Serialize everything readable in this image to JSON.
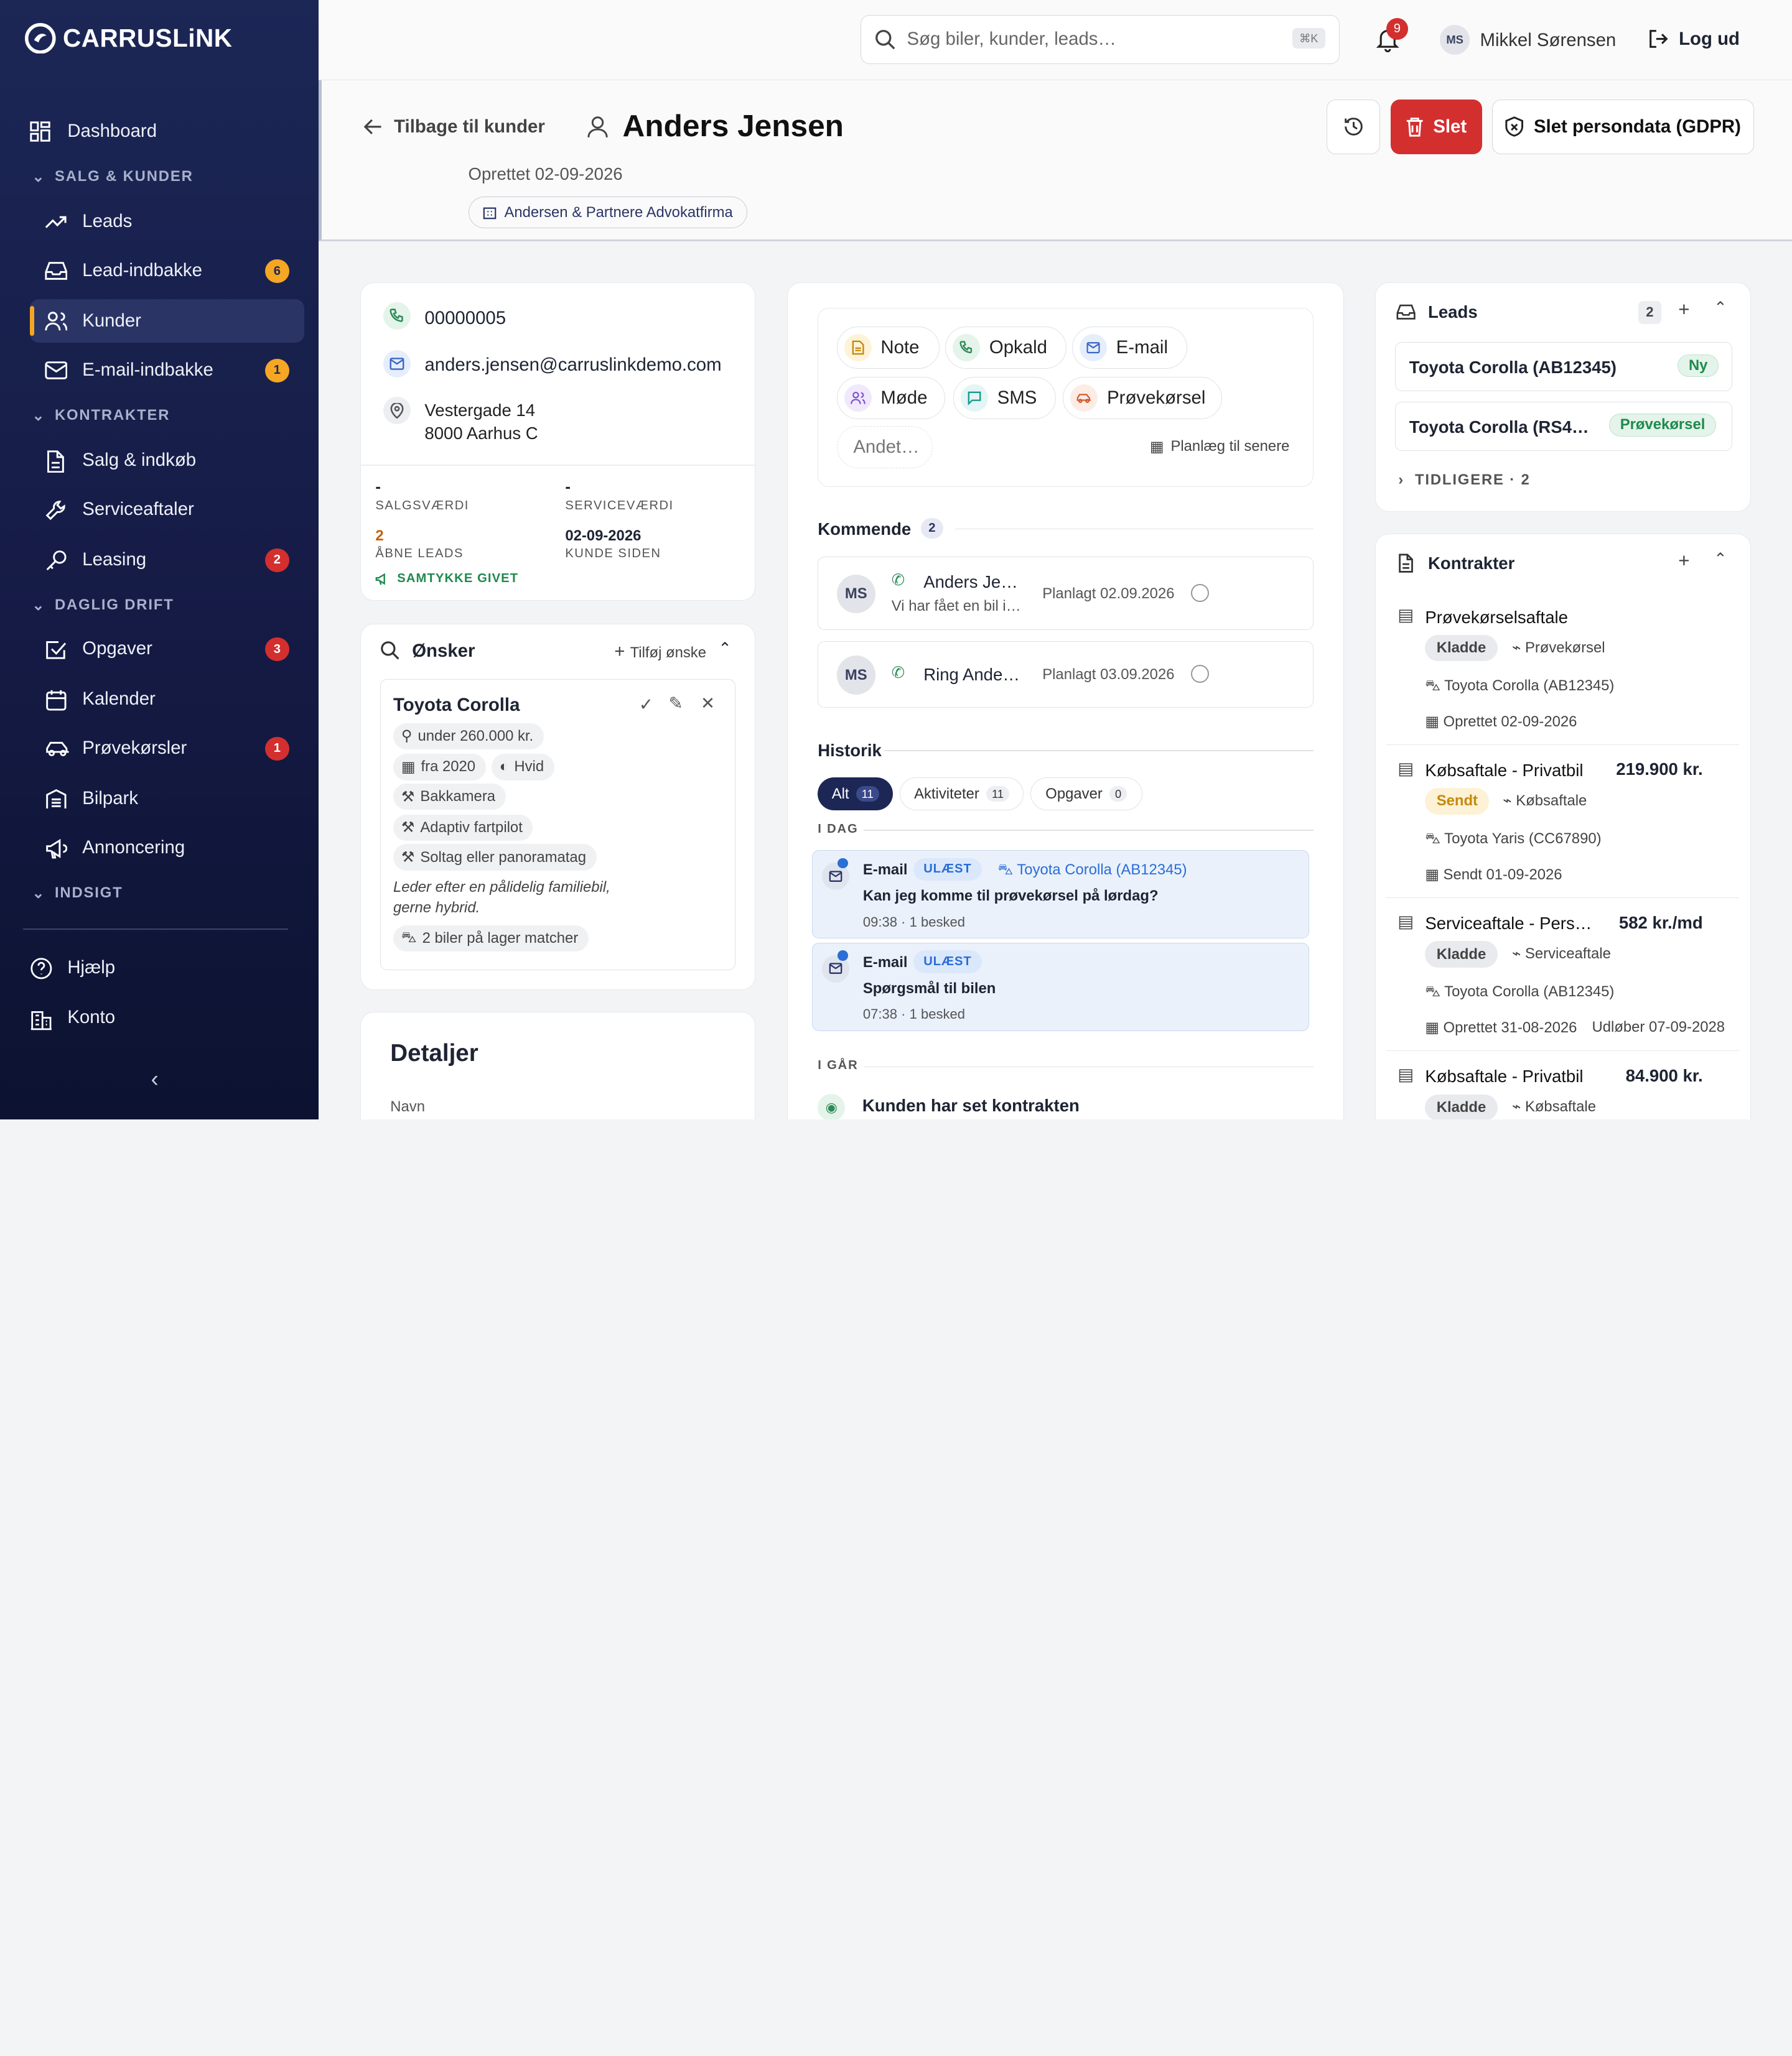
{
  "app": {
    "brand": "CARRUSLiNK"
  },
  "sidebar": {
    "dashboard": "Dashboard",
    "sections": [
      "SALG & KUNDER",
      "KONTRAKTER",
      "DAGLIG DRIFT",
      "INDSIGT"
    ],
    "items": [
      {
        "label": "Leads"
      },
      {
        "label": "Lead-indbakke",
        "badge": "6"
      },
      {
        "label": "Kunder"
      },
      {
        "label": "E-mail-indbakke",
        "badge": "1"
      },
      {
        "label": "Salg & indkøb"
      },
      {
        "label": "Serviceaftaler"
      },
      {
        "label": "Leasing",
        "badge": "2"
      },
      {
        "label": "Opgaver",
        "badge": "3"
      },
      {
        "label": "Kalender"
      },
      {
        "label": "Prøvekørsler",
        "badge": "1"
      },
      {
        "label": "Bilpark"
      },
      {
        "label": "Annoncering"
      }
    ],
    "help": "Hjælp",
    "account": "Konto"
  },
  "topbar": {
    "search_placeholder": "Søg biler, kunder, leads…",
    "shortcut": "⌘K",
    "notif_count": "9",
    "user_initials": "MS",
    "user_name": "Mikkel Sørensen",
    "logout": "Log ud"
  },
  "header": {
    "back": "Tilbage til kunder",
    "name": "Anders Jensen",
    "created": "Oprettet 02-09-2026",
    "company": "Andersen & Partnere Advokatfirma",
    "delete": "Slet",
    "gdpr": "Slet persondata (GDPR)"
  },
  "contact": {
    "phone": "00000005",
    "email": "anders.jensen@carruslinkdemo.com",
    "address1": "Vestergade 14",
    "address2": "8000 Aarhus C",
    "stats": {
      "salesval": "-",
      "salesval_lbl": "SALGSVÆRDI",
      "serviceval": "-",
      "serviceval_lbl": "SERVICEVÆRDI",
      "open_leads": "2",
      "open_leads_lbl": "ÅBNE LEADS",
      "since": "02-09-2026",
      "since_lbl": "KUNDE SIDEN",
      "consent": "SAMTYKKE GIVET"
    }
  },
  "wishes": {
    "title": "Ønsker",
    "add": "Tilføj ønske",
    "car": "Toyota Corolla",
    "price": "under 260.000 kr.",
    "year": "fra 2020",
    "color": "Hvid",
    "f1": "Bakkamera",
    "f2": "Adaptiv fartpilot",
    "f3": "Soltag eller panoramatag",
    "note1": "Leder efter en pålidelig familiebil,",
    "note2": "gerne hybrid.",
    "match": "2 biler på lager matcher"
  },
  "details": {
    "title": "Detaljer",
    "name_lbl": "Navn"
  },
  "activity": {
    "note": "Note",
    "call": "Opkald",
    "email": "E-mail",
    "meeting": "Møde",
    "sms": "SMS",
    "testdrive": "Prøvekørsel",
    "other": "Andet…",
    "schedule": "Planlæg til senere"
  },
  "upcoming": {
    "title": "Kommende",
    "count": "2",
    "items": [
      {
        "initials": "MS",
        "title": "Anders Je…",
        "sub": "Vi har fået en bil i…",
        "date": "Planlagt 02.09.2026"
      },
      {
        "initials": "MS",
        "title": "Ring Ande…",
        "sub": "",
        "date": "Planlagt 03.09.2026"
      }
    ]
  },
  "history": {
    "title": "Historik",
    "tabs": [
      {
        "label": "Alt",
        "count": "11"
      },
      {
        "label": "Aktiviteter",
        "count": "11"
      },
      {
        "label": "Opgaver",
        "count": "0"
      }
    ],
    "today": "I DAG",
    "yesterday": "I GÅR",
    "items": [
      {
        "type": "E-mail",
        "badge": "ULÆST",
        "car": "Toyota Corolla (AB12345)",
        "subject": "Kan jeg komme til prøvekørsel på lørdag?",
        "time": "09:38",
        "meta": "· 1 besked"
      },
      {
        "type": "E-mail",
        "badge": "ULÆST",
        "car": "",
        "subject": "Spørgsmål til bilen",
        "time": "07:38",
        "meta": "· 1 besked"
      }
    ],
    "yest_item": "Kunden har set kontrakten"
  },
  "leads": {
    "title": "Leads",
    "count": "2",
    "items": [
      {
        "car": "Toyota Corolla (AB12345)",
        "status": "Ny"
      },
      {
        "car": "Toyota Corolla (RS4…",
        "status": "Prøvekørsel"
      }
    ],
    "earlier": "TIDLIGERE · 2"
  },
  "contracts": {
    "title": "Kontrakter",
    "items": [
      {
        "title": "Prøvekørselsaftale",
        "price": "",
        "status": "Kladde",
        "type": "Prøvekørsel",
        "car": "Toyota Corolla (AB12345)",
        "date": "Oprettet 02-09-2026",
        "extra": ""
      },
      {
        "title": "Købsaftale - Privatbil",
        "price": "219.900 kr.",
        "status": "Sendt",
        "type": "Købsaftale",
        "car": "Toyota Yaris (CC67890)",
        "date": "Sendt 01-09-2026",
        "extra": ""
      },
      {
        "title": "Serviceaftale - Pers…",
        "price": "582 kr./md",
        "status": "Kladde",
        "type": "Serviceaftale",
        "car": "Toyota Corolla (AB12345)",
        "date": "Oprettet 31-08-2026",
        "extra": "Udløber 07-09-2028"
      },
      {
        "title": "Købsaftale - Privatbil",
        "price": "84.900 kr.",
        "status": "Kladde",
        "type": "Købsaftale",
        "car": "",
        "date": "",
        "extra": ""
      }
    ]
  },
  "colors": {
    "sidebar": "#1c2756",
    "accent": "#f5a623",
    "danger": "#d32f2f",
    "unread_bg": "#eaf1fb"
  }
}
